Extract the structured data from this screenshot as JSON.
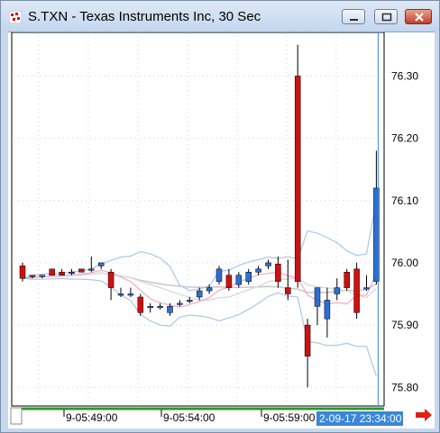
{
  "window": {
    "title": "S.TXN - Texas Instruments Inc, 30 Sec",
    "app_icon": "tradestation-chart-icon",
    "buttons": [
      "minimize",
      "maximize",
      "close"
    ]
  },
  "time_axis": {
    "labels": [
      "9-05:49:00",
      "9-05:54:00",
      "9-05:59:00"
    ],
    "highlight_label": "2-09-17 23:34:00"
  },
  "colors": {
    "up": "#2a6fd6",
    "down": "#d01010",
    "bollinger": "#a8c8ea",
    "ma_gray": "#c8c8c8",
    "ma_pink": "#f0a8c8",
    "cursor": "#3a86d8",
    "highlight_bg": "#3a86d8",
    "scroll_green": "#2a9a2a",
    "nav_arrow": "#e02010"
  },
  "chart_data": {
    "type": "candlestick",
    "symbol": "S.TXN",
    "interval": "30 Sec",
    "ylim": [
      75.77,
      76.37
    ],
    "yticks": [
      "76.30",
      "76.20",
      "76.10",
      "76.00",
      "75.90",
      "75.80"
    ],
    "grid": true,
    "candles": [
      {
        "o": 75.995,
        "h": 76.0,
        "l": 75.97,
        "c": 75.975
      },
      {
        "o": 75.98,
        "h": 75.98,
        "l": 75.975,
        "c": 75.978
      },
      {
        "o": 75.98,
        "h": 75.98,
        "l": 75.975,
        "c": 75.98
      },
      {
        "o": 75.99,
        "h": 75.99,
        "l": 75.98,
        "c": 75.98
      },
      {
        "o": 75.985,
        "h": 75.99,
        "l": 75.98,
        "c": 75.98
      },
      {
        "o": 75.985,
        "h": 75.99,
        "l": 75.98,
        "c": 75.985
      },
      {
        "o": 75.99,
        "h": 75.99,
        "l": 75.985,
        "c": 75.985
      },
      {
        "o": 75.99,
        "h": 76.01,
        "l": 75.985,
        "c": 75.99
      },
      {
        "o": 75.995,
        "h": 76.0,
        "l": 75.99,
        "c": 76.0
      },
      {
        "o": 75.985,
        "h": 75.99,
        "l": 75.94,
        "c": 75.96
      },
      {
        "o": 75.95,
        "h": 75.96,
        "l": 75.945,
        "c": 75.95
      },
      {
        "o": 75.95,
        "h": 75.96,
        "l": 75.945,
        "c": 75.95
      },
      {
        "o": 75.945,
        "h": 75.95,
        "l": 75.915,
        "c": 75.92
      },
      {
        "o": 75.93,
        "h": 75.935,
        "l": 75.92,
        "c": 75.93
      },
      {
        "o": 75.93,
        "h": 75.935,
        "l": 75.925,
        "c": 75.93
      },
      {
        "o": 75.92,
        "h": 75.935,
        "l": 75.915,
        "c": 75.93
      },
      {
        "o": 75.935,
        "h": 75.94,
        "l": 75.93,
        "c": 75.935
      },
      {
        "o": 75.94,
        "h": 75.945,
        "l": 75.935,
        "c": 75.94
      },
      {
        "o": 75.945,
        "h": 75.96,
        "l": 75.94,
        "c": 75.955
      },
      {
        "o": 75.955,
        "h": 75.965,
        "l": 75.95,
        "c": 75.96
      },
      {
        "o": 75.97,
        "h": 75.995,
        "l": 75.965,
        "c": 75.99
      },
      {
        "o": 75.98,
        "h": 75.99,
        "l": 75.955,
        "c": 75.96
      },
      {
        "o": 75.965,
        "h": 75.985,
        "l": 75.96,
        "c": 75.98
      },
      {
        "o": 75.97,
        "h": 75.99,
        "l": 75.965,
        "c": 75.985
      },
      {
        "o": 75.985,
        "h": 75.995,
        "l": 75.98,
        "c": 75.99
      },
      {
        "o": 75.995,
        "h": 76.005,
        "l": 75.99,
        "c": 76.0
      },
      {
        "o": 75.998,
        "h": 76.01,
        "l": 75.96,
        "c": 75.97
      },
      {
        "o": 75.96,
        "h": 76.005,
        "l": 75.94,
        "c": 75.95
      },
      {
        "o": 76.3,
        "h": 76.35,
        "l": 75.96,
        "c": 75.97
      },
      {
        "o": 75.9,
        "h": 75.91,
        "l": 75.8,
        "c": 75.85
      },
      {
        "o": 75.93,
        "h": 75.96,
        "l": 75.9,
        "c": 75.96
      },
      {
        "o": 75.91,
        "h": 75.96,
        "l": 75.88,
        "c": 75.94
      },
      {
        "o": 75.95,
        "h": 75.975,
        "l": 75.94,
        "c": 75.96
      },
      {
        "o": 75.985,
        "h": 75.99,
        "l": 75.955,
        "c": 75.96
      },
      {
        "o": 75.99,
        "h": 76.0,
        "l": 75.91,
        "c": 75.92
      },
      {
        "o": 75.96,
        "h": 75.98,
        "l": 75.955,
        "c": 75.96
      },
      {
        "o": 75.97,
        "h": 76.18,
        "l": 75.965,
        "c": 76.12
      }
    ]
  }
}
